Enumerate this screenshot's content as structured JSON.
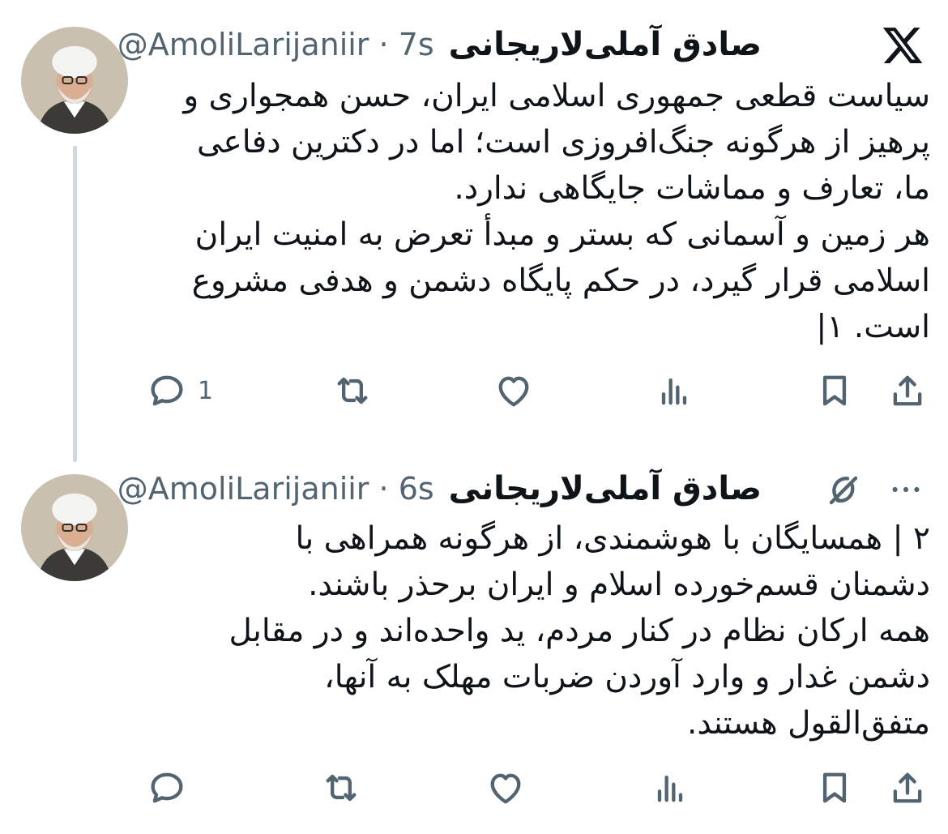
{
  "tweets": [
    {
      "name": "صادق آملی‌لاریجانی",
      "handle": "@AmoliLarijaniir",
      "time": "· 7s",
      "text": "سیاست قطعی جمهوری اسلامی ایران، حسن همجواری و\nپرهیز از هرگونه جنگ‌افروزی است؛ اما در دکترین دفاعی\nما، تعارف و مماشات جایگاهی ندارد.\nهر زمین و آسمانی که بستر و مبدأ تعرض به امنیت ایران\nاسلامی قرار گیرد، در حکم پایگاه دشمن و هدفی مشروع\nاست. ۱|",
      "reply_count": "1",
      "top_icon": "x-logo-icon"
    },
    {
      "name": "صادق آملی‌لاریجانی",
      "handle": "@AmoliLarijaniir",
      "time": "· 6s",
      "text": "۲ | همسایگان با هوشمندی، از هرگونه همراهی با\nدشمنان قسم‌خورده اسلام و ایران برحذر باشند.\nهمه ارکان نظام در کنار مردم، ید واحده‌اند و در مقابل\nدشمن غدار و وارد آوردن ضربات مهلک به آنها،\nمتفق‌القول هستند.",
      "reply_count": "",
      "top_icon": "grok-icon",
      "more_icon": "more-options-icon"
    }
  ],
  "action_icons": [
    "reply-icon",
    "retweet-icon",
    "like-icon",
    "views-icon",
    "bookmark-icon",
    "share-icon"
  ],
  "colors": {
    "text": "#0f1419",
    "secondary": "#536471",
    "thread_line": "#cfd9de",
    "background": "#ffffff"
  }
}
